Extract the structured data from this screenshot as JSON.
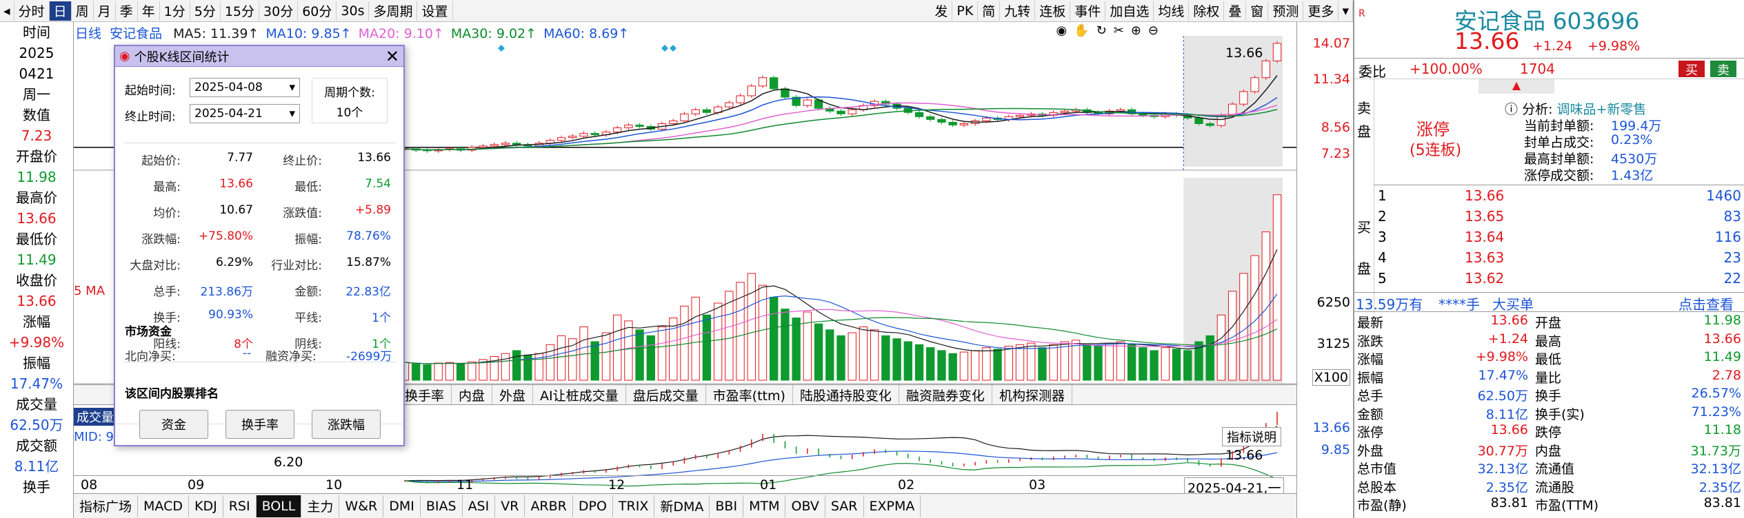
{
  "toolbar": {
    "left_items": [
      "分时",
      "日",
      "周",
      "月",
      "季",
      "年",
      "1分",
      "5分",
      "15分",
      "30分",
      "60分",
      "30s",
      "多周期",
      "设置"
    ],
    "active": "日",
    "right_items": [
      "发",
      "PK",
      "简",
      "九转",
      "连板",
      "事件",
      "加自选",
      "均线",
      "除权",
      "叠",
      "窗",
      "预测",
      "更多"
    ]
  },
  "left_info": [
    {
      "label": "时间",
      "value": ""
    },
    {
      "label": "2025",
      "value": ""
    },
    {
      "label": "0421",
      "value": ""
    },
    {
      "label": "周一",
      "value": ""
    },
    {
      "label": "数值",
      "value": "7.23"
    },
    {
      "label": "开盘价",
      "value": "11.98"
    },
    {
      "label": "最高价",
      "value": "13.66"
    },
    {
      "label": "最低价",
      "value": "11.49"
    },
    {
      "label": "收盘价",
      "value": "13.66"
    },
    {
      "label": "涨幅",
      "value": "+9.98%"
    },
    {
      "label": "振幅",
      "value": "17.47%"
    },
    {
      "label": "成交量",
      "value": "62.50万"
    },
    {
      "label": "成交额",
      "value": "8.11亿"
    },
    {
      "label": "换手",
      "value": ""
    }
  ],
  "ma_legend": {
    "prefix": "日线",
    "name": "安记食品",
    "items": [
      {
        "label": "MA5: 11.39↑",
        "color": "#1a1a1a"
      },
      {
        "label": "MA10: 9.85↑",
        "color": "#1c55d6"
      },
      {
        "label": "MA20: 9.10↑",
        "color": "#e060d0"
      },
      {
        "label": "MA30: 9.02↑",
        "color": "#0e8a2e"
      },
      {
        "label": "MA60: 8.69↑",
        "color": "#1c55d6"
      }
    ]
  },
  "price_axis": [
    "14.07",
    "11.34",
    "8.56",
    "7.23"
  ],
  "volume_axis": [
    "6250",
    "3125",
    "X100"
  ],
  "indicator_axis": [
    "13.66",
    "9.85"
  ],
  "chart_labels": {
    "high_marker": "13.66",
    "mid_left": "MID: 9",
    "boll_val": "6.20",
    "vol_left": "成交量",
    "ind_high": "13.66",
    "ind_explain": "指标说明",
    "cursor_date": "2025-04-21,一",
    "ma_left": "5 MA"
  },
  "tabs": [
    "换手率",
    "内盘",
    "外盘",
    "AI让桩成交量",
    "盘后成交量",
    "市盈率(ttm)",
    "陆股通持股变化",
    "融资融券变化",
    "机构探测器"
  ],
  "x_axis": [
    "08",
    "09",
    "10",
    "11",
    "12",
    "01",
    "02",
    "03"
  ],
  "indicator_tabs": [
    "指标广场",
    "MACD",
    "KDJ",
    "RSI",
    "BOLL",
    "主力",
    "W&R",
    "DMI",
    "BIAS",
    "ASI",
    "VR",
    "ARBR",
    "DPO",
    "TRIX",
    "新DMA",
    "BBI",
    "MTM",
    "OBV",
    "SAR",
    "EXPMA"
  ],
  "active_indicator": "BOLL",
  "dialog": {
    "title": "个股K线区间统计",
    "start_label": "起始时间:",
    "start_value": "2025-04-08",
    "end_label": "终止时间:",
    "end_value": "2025-04-21",
    "period_label": "周期个数:",
    "period_value": "10个",
    "stats": [
      {
        "l1": "起始价:",
        "v1": "7.77",
        "c1": "#000",
        "l2": "终止价:",
        "v2": "13.66",
        "c2": "#000"
      },
      {
        "l1": "最高:",
        "v1": "13.66",
        "c1": "#e0191e",
        "l2": "最低:",
        "v2": "7.54",
        "c2": "#0e9a2e"
      },
      {
        "l1": "均价:",
        "v1": "10.67",
        "c1": "#000",
        "l2": "涨跌值:",
        "v2": "+5.89",
        "c2": "#e0191e"
      },
      {
        "l1": "涨跌幅:",
        "v1": "+75.80%",
        "c1": "#e0191e",
        "l2": "振幅:",
        "v2": "78.76%",
        "c2": "#1c55d6"
      },
      {
        "l1": "大盘对比:",
        "v1": "6.29%",
        "c1": "#000",
        "l2": "行业对比:",
        "v2": "15.87%",
        "c2": "#000"
      },
      {
        "l1": "总手:",
        "v1": "213.86万",
        "c1": "#1c55d6",
        "l2": "金额:",
        "v2": "22.83亿",
        "c2": "#1c55d6"
      },
      {
        "l1": "换手:",
        "v1": "90.93%",
        "c1": "#1c55d6",
        "l2": "平线:",
        "v2": "1个",
        "c2": "#1c55d6"
      },
      {
        "l1": "阳线:",
        "v1": "8个",
        "c1": "#e0191e",
        "l2": "阴线:",
        "v2": "1个",
        "c2": "#0e9a2e"
      }
    ],
    "market_title": "市场资金",
    "north_label": "北向净买:",
    "north_value": "--",
    "margin_label": "融资净买:",
    "margin_value": "-2699万",
    "rank_title": "该区间内股票排名",
    "buttons": [
      "资金",
      "换手率",
      "涨跌幅"
    ]
  },
  "panel": {
    "name": "安记食品 603696",
    "price": "13.66",
    "change": "+1.24",
    "pct": "+9.98%",
    "wb_label": "委比",
    "wb_value": "+100.00%",
    "wb_count": "1704",
    "buy_btn": "买",
    "sell_btn": "卖",
    "sell_side": "卖盘",
    "limit_status": "涨停",
    "limit_days": "(5连板)",
    "analysis_label": "分析:",
    "analysis_value": "调味品+新零售",
    "seal_rows": [
      {
        "label": "当前封单额:",
        "value": "199.4万"
      },
      {
        "label": "封单占成交:",
        "value": "0.23%"
      },
      {
        "label": "最高封单额:",
        "value": "4530万"
      },
      {
        "label": "涨停成交额:",
        "value": "1.43亿"
      }
    ],
    "buy_side": "买盘",
    "bids": [
      {
        "lvl": "1",
        "price": "13.66",
        "vol": "1460"
      },
      {
        "lvl": "2",
        "price": "13.65",
        "vol": "83"
      },
      {
        "lvl": "3",
        "price": "13.64",
        "vol": "116"
      },
      {
        "lvl": "4",
        "price": "13.63",
        "vol": "23"
      },
      {
        "lvl": "5",
        "price": "13.62",
        "vol": "22"
      }
    ],
    "tick_price": "13.59万有",
    "tick_hand": "****手",
    "tick_big": "大买单",
    "tick_view": "点击查看",
    "quotes": [
      {
        "l1": "最新",
        "v1": "13.66",
        "c1": "#e0191e",
        "l2": "开盘",
        "v2": "11.98",
        "c2": "#0e9a2e"
      },
      {
        "l1": "涨跌",
        "v1": "+1.24",
        "c1": "#e0191e",
        "l2": "最高",
        "v2": "13.66",
        "c2": "#e0191e"
      },
      {
        "l1": "涨幅",
        "v1": "+9.98%",
        "c1": "#e0191e",
        "l2": "最低",
        "v2": "11.49",
        "c2": "#0e9a2e"
      },
      {
        "l1": "振幅",
        "v1": "17.47%",
        "c1": "#1c55d6",
        "l2": "量比",
        "v2": "2.78",
        "c2": "#e0191e"
      },
      {
        "l1": "总手",
        "v1": "62.50万",
        "c1": "#1c55d6",
        "l2": "换手",
        "v2": "26.57%",
        "c2": "#1c55d6"
      },
      {
        "l1": "金额",
        "v1": "8.11亿",
        "c1": "#1c55d6",
        "l2": "换手(实)",
        "v2": "71.23%",
        "c2": "#1c55d6"
      },
      {
        "l1": "涨停",
        "v1": "13.66",
        "c1": "#e0191e",
        "l2": "跌停",
        "v2": "11.18",
        "c2": "#0e9a2e"
      },
      {
        "l1": "外盘",
        "v1": "30.77万",
        "c1": "#e0191e",
        "l2": "内盘",
        "v2": "31.73万",
        "c2": "#0e9a2e"
      },
      {
        "l1": "总市值",
        "v1": "32.13亿",
        "c1": "#1c55d6",
        "l2": "流通值",
        "v2": "32.13亿",
        "c2": "#1c55d6"
      },
      {
        "l1": "总股本",
        "v1": "2.35亿",
        "c1": "#1c55d6",
        "l2": "流通股",
        "v2": "2.35亿",
        "c2": "#1c55d6"
      },
      {
        "l1": "市盈(静)",
        "v1": "83.81",
        "c1": "#000",
        "l2": "市盈(TTM)",
        "v2": "83.81",
        "c2": "#000"
      }
    ]
  },
  "chart_data": {
    "type": "candlestick",
    "x_ticks": [
      "08",
      "09",
      "10",
      "11",
      "12",
      "01",
      "02",
      "03"
    ],
    "price_ticks": [
      14.07,
      11.34,
      8.56,
      7.23
    ],
    "last_close": 13.66,
    "closes": [
      6.1,
      6.0,
      5.95,
      6.05,
      6.1,
      6.0,
      6.2,
      6.3,
      6.4,
      6.5,
      6.4,
      6.3,
      6.5,
      6.7,
      6.9,
      7.0,
      7.2,
      7.1,
      7.3,
      7.6,
      7.8,
      7.7,
      7.5,
      7.9,
      8.1,
      8.6,
      8.9,
      8.7,
      9.1,
      9.4,
      9.9,
      10.6,
      11.2,
      10.4,
      9.8,
      9.2,
      9.6,
      9.0,
      8.8,
      8.6,
      8.9,
      9.2,
      9.5,
      9.3,
      9.0,
      8.7,
      8.4,
      8.2,
      8.0,
      7.8,
      7.9,
      8.1,
      8.3,
      8.2,
      8.4,
      8.5,
      8.6,
      8.5,
      8.7,
      8.8,
      8.9,
      8.7,
      8.6,
      8.8,
      8.9,
      8.6,
      8.5,
      8.4,
      8.6,
      8.5,
      8.3,
      7.9,
      7.77,
      8.5,
      9.3,
      10.2,
      11.2,
      12.4,
      13.66
    ],
    "volumes": [
      600,
      550,
      520,
      580,
      600,
      560,
      620,
      700,
      800,
      900,
      1000,
      850,
      900,
      1200,
      1500,
      1400,
      1800,
      1300,
      1600,
      2200,
      2000,
      1700,
      1500,
      1800,
      2100,
      2500,
      2800,
      2200,
      2600,
      3000,
      3300,
      3600,
      3200,
      2800,
      2400,
      2100,
      2300,
      1900,
      1700,
      1500,
      1600,
      1800,
      1700,
      1500,
      1400,
      1300,
      1200,
      1100,
      1000,
      900,
      950,
      1000,
      1100,
      1050,
      1150,
      1200,
      1250,
      1100,
      1200,
      1300,
      1350,
      1200,
      1150,
      1250,
      1300,
      1200,
      1100,
      1000,
      1100,
      1050,
      1000,
      1300,
      1500,
      2200,
      3000,
      3600,
      4200,
      5000,
      6250
    ]
  }
}
